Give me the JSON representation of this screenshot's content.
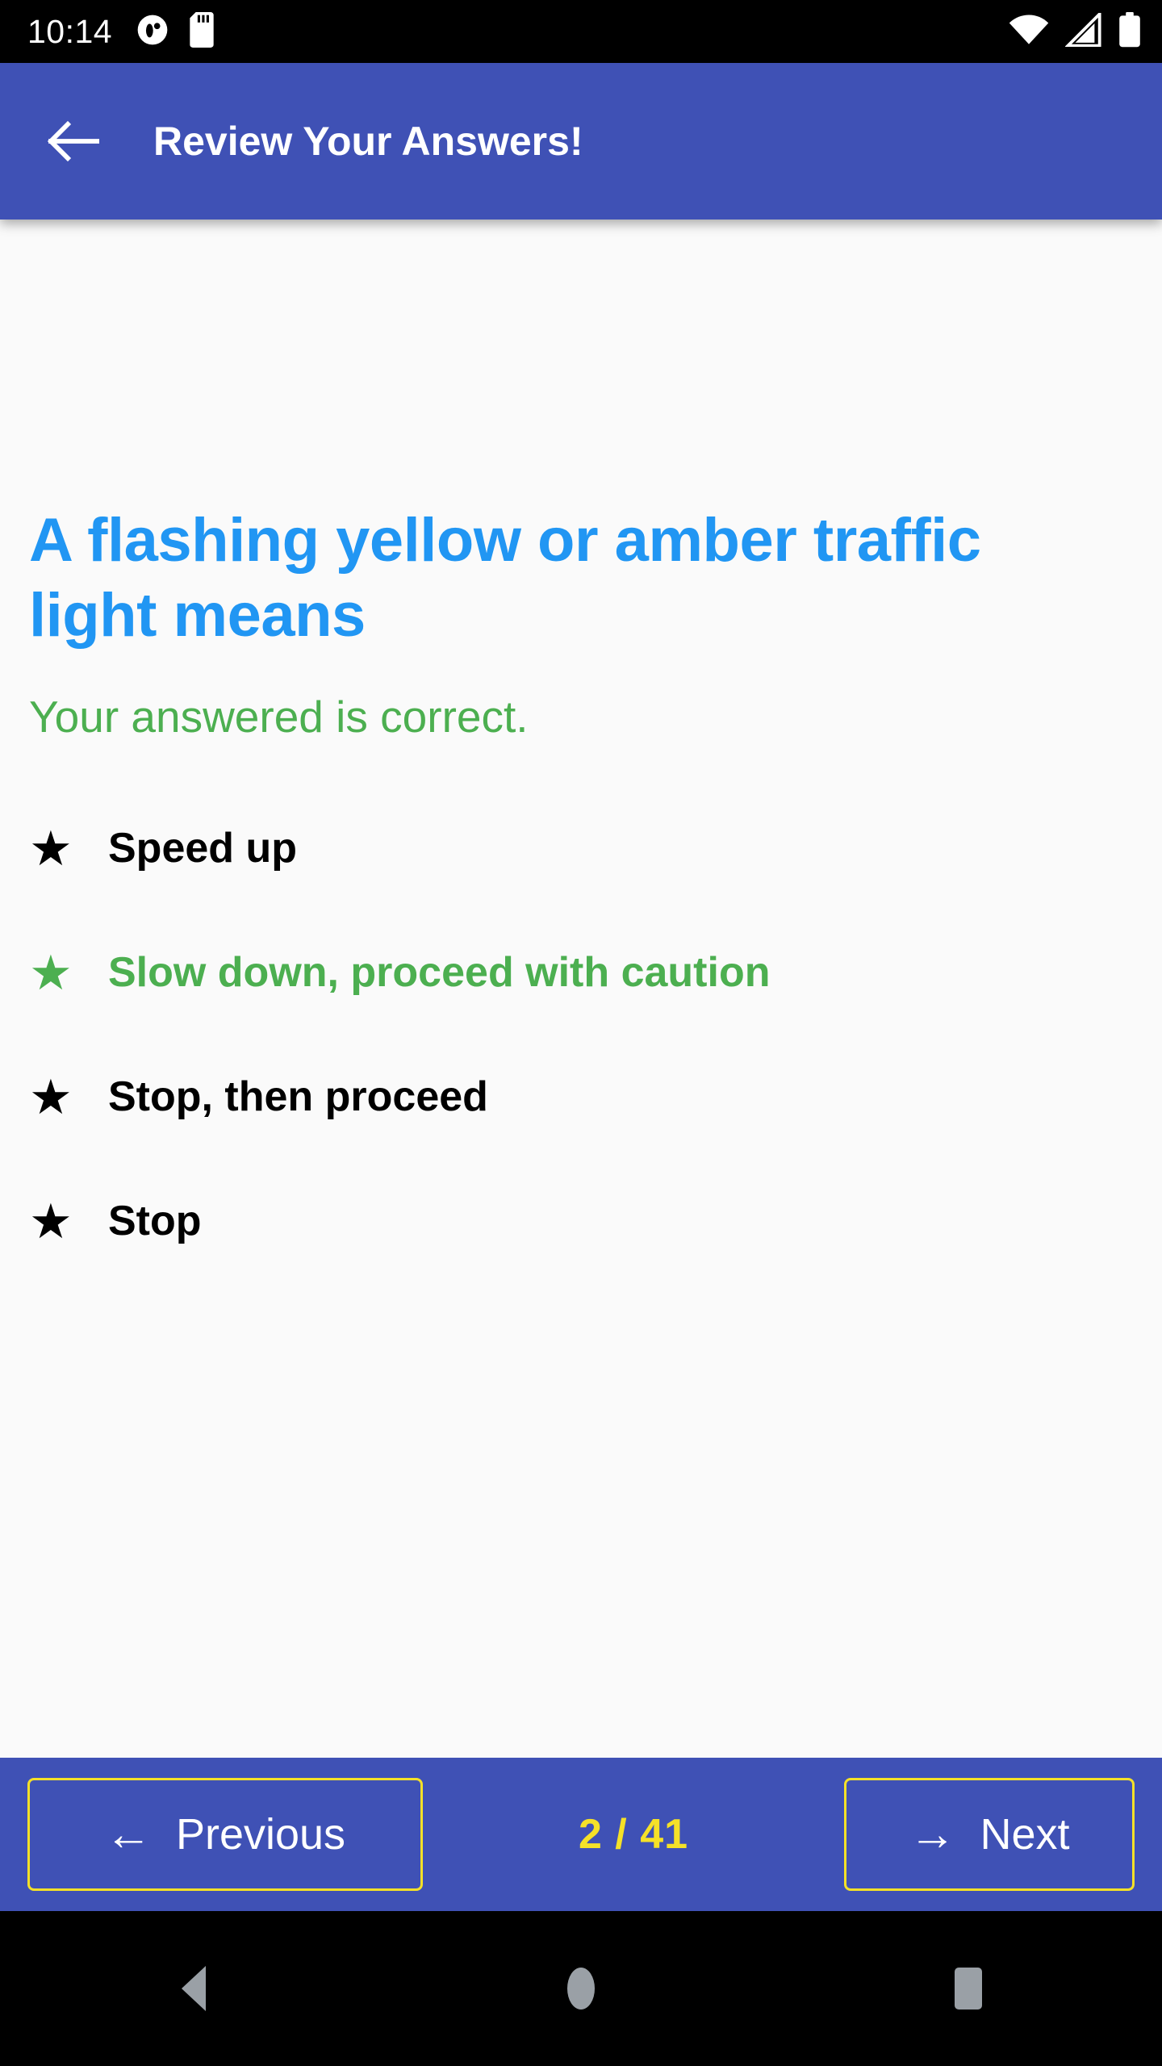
{
  "status_bar": {
    "time": "10:14",
    "left_icons": [
      "do-not-disturb-icon",
      "sd-card-icon"
    ],
    "right_icons": [
      "wifi-icon",
      "cellular-signal-icon",
      "battery-icon"
    ],
    "background_color": "#000000"
  },
  "app_bar": {
    "title": "Review Your Answers!",
    "back_icon": "arrow-left-icon",
    "background_color": "#3F51B5",
    "text_color": "#FFFFFF"
  },
  "question": {
    "text": "A flashing yellow or amber traffic light means",
    "text_color": "#2196F3",
    "result_message": "Your answered is correct.",
    "result_color": "#4CAF50"
  },
  "options": [
    {
      "label": "Speed up",
      "is_correct": false,
      "star_icon": "star-icon",
      "color": "#000000"
    },
    {
      "label": "Slow down, proceed with caution",
      "is_correct": true,
      "star_icon": "star-icon",
      "color": "#4CAF50"
    },
    {
      "label": "Stop, then proceed",
      "is_correct": false,
      "star_icon": "star-icon",
      "color": "#000000"
    },
    {
      "label": "Stop",
      "is_correct": false,
      "star_icon": "star-icon",
      "color": "#000000"
    }
  ],
  "bottom_nav": {
    "previous_label": "Previous",
    "previous_arrow": "←",
    "previous_icon": "arrow-left-icon",
    "next_label": "Next",
    "next_arrow": "→",
    "next_icon": "arrow-right-icon",
    "counter": "2 / 41",
    "current_page": 2,
    "total_pages": 41,
    "border_color": "#F5E128",
    "counter_color": "#F5E128",
    "background_color": "#3F51B5"
  },
  "android_nav": {
    "back_icon": "triangle-back-icon",
    "home_icon": "circle-home-icon",
    "recents_icon": "square-recents-icon"
  }
}
